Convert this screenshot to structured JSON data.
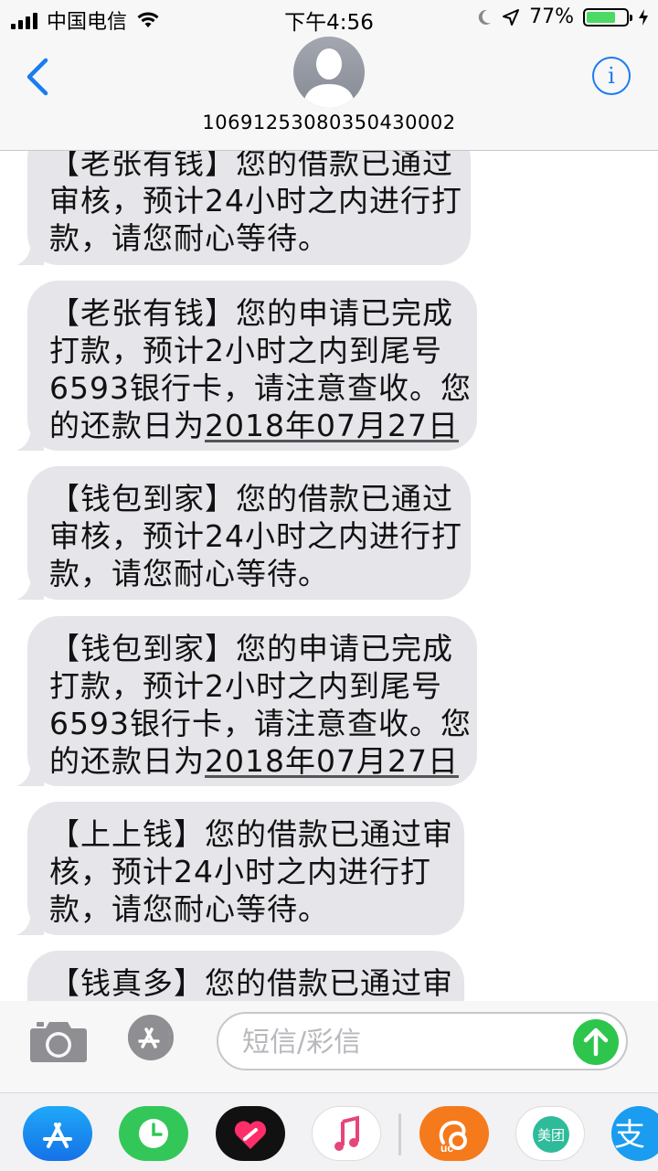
{
  "status_bar": {
    "carrier": "中国电信",
    "time": "下午4:56",
    "battery_percent": "77%",
    "battery_level": 0.77
  },
  "header": {
    "contact_number": "10691253080350430002",
    "info_label": "i"
  },
  "messages": [
    {
      "lines": [
        "【老张有钱】您的借款已通过",
        "审核，预计24小时之内进行打",
        "款，请您耐心等待。"
      ]
    },
    {
      "lines": [
        "【老张有钱】您的申请已完成",
        "打款，预计2小时之内到尾号",
        "6593银行卡，请注意查收。您"
      ],
      "last_prefix": "的还款日为",
      "last_link": "2018年07月27日"
    },
    {
      "lines": [
        "【钱包到家】您的借款已通过",
        "审核，预计24小时之内进行打",
        "款，请您耐心等待。"
      ]
    },
    {
      "lines": [
        "【钱包到家】您的申请已完成",
        "打款，预计2小时之内到尾号",
        "6593银行卡，请注意查收。您"
      ],
      "last_prefix": "的还款日为",
      "last_link": "2018年07月27日"
    },
    {
      "lines": [
        "【上上钱】您的借款已通过审",
        "核，预计24小时之内进行打",
        "款，请您耐心等待。"
      ]
    },
    {
      "lines": [
        "【钱真多】您的借款已通过审"
      ]
    }
  ],
  "composer": {
    "placeholder": "短信/彩信"
  },
  "app_drawer": {
    "apps": [
      {
        "name": "app-store",
        "icon": "app-store-icon"
      },
      {
        "name": "clock",
        "icon": "clock-icon"
      },
      {
        "name": "digital-touch",
        "icon": "heart-icon"
      },
      {
        "name": "music",
        "icon": "music-note-icon"
      },
      {
        "name": "uc-browser",
        "icon": "squirrel-icon"
      },
      {
        "name": "meituan",
        "icon": "meituan-icon",
        "label": "美团"
      },
      {
        "name": "alipay",
        "icon": "alipay-icon",
        "label": "支"
      }
    ]
  },
  "colors": {
    "accent_blue": "#1a7cf0",
    "bubble_gray": "#e5e5ea",
    "send_green": "#2dc54b",
    "battery_green": "#4cd964"
  }
}
